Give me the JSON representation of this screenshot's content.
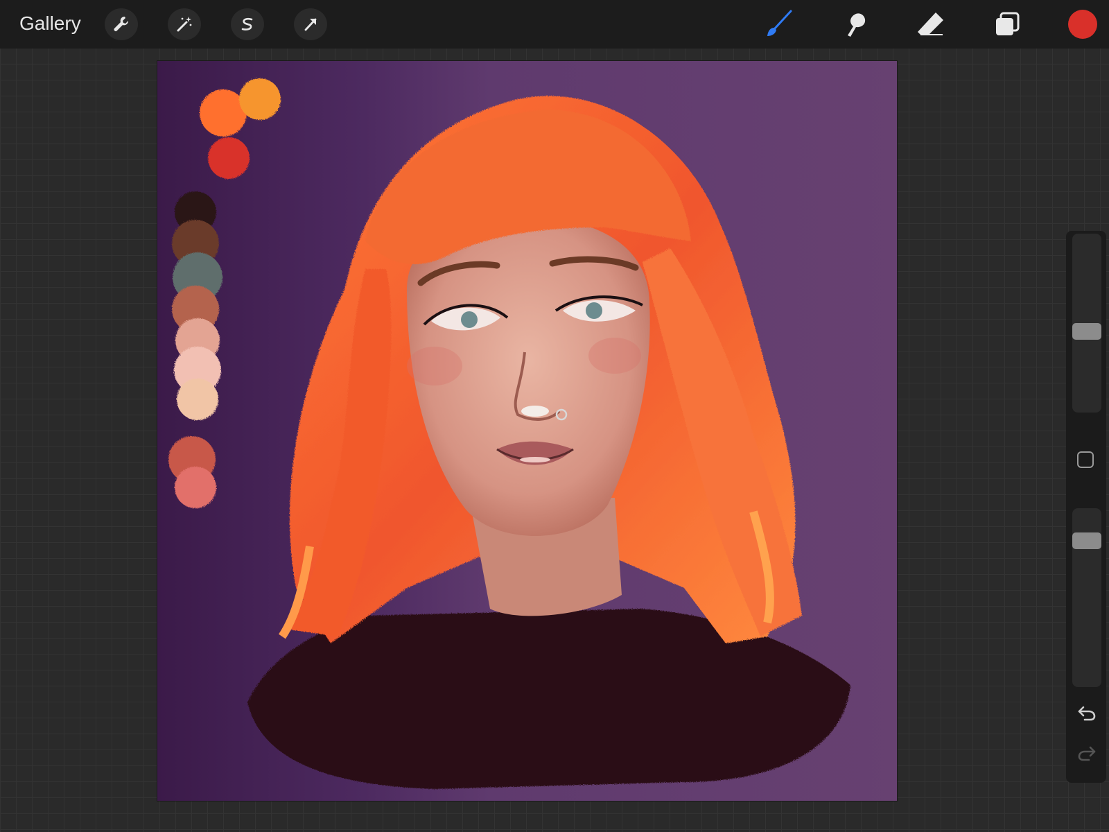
{
  "toolbar": {
    "gallery_label": "Gallery",
    "left_tools": [
      "wrench-icon",
      "magic-wand-icon",
      "selection-s-icon",
      "transform-arrow-icon"
    ],
    "right_tools": [
      "brush-icon",
      "smudge-icon",
      "eraser-icon",
      "layers-icon"
    ],
    "active_tool": "brush-icon",
    "active_color": "#d9302a",
    "brush_tool_color": "#2f7bf5"
  },
  "canvas": {
    "subject": "",
    "background_colors": [
      "#3b1a49",
      "#674171"
    ],
    "palette_swatches": [
      "#ff6f2e",
      "#f6952d",
      "#d9322c",
      "#2a1214",
      "#6b3b2a",
      "#5f6e6c",
      "#b4634d",
      "#e3a493",
      "#f2c0b3",
      "#f1c5a6",
      "#c8584a",
      "#e26f6b"
    ]
  },
  "sidebar": {
    "brush_size_level": 0.45,
    "opacity_level": 0.15,
    "undo_icon": "undo-arrow-icon",
    "redo_icon": "redo-arrow-icon"
  }
}
